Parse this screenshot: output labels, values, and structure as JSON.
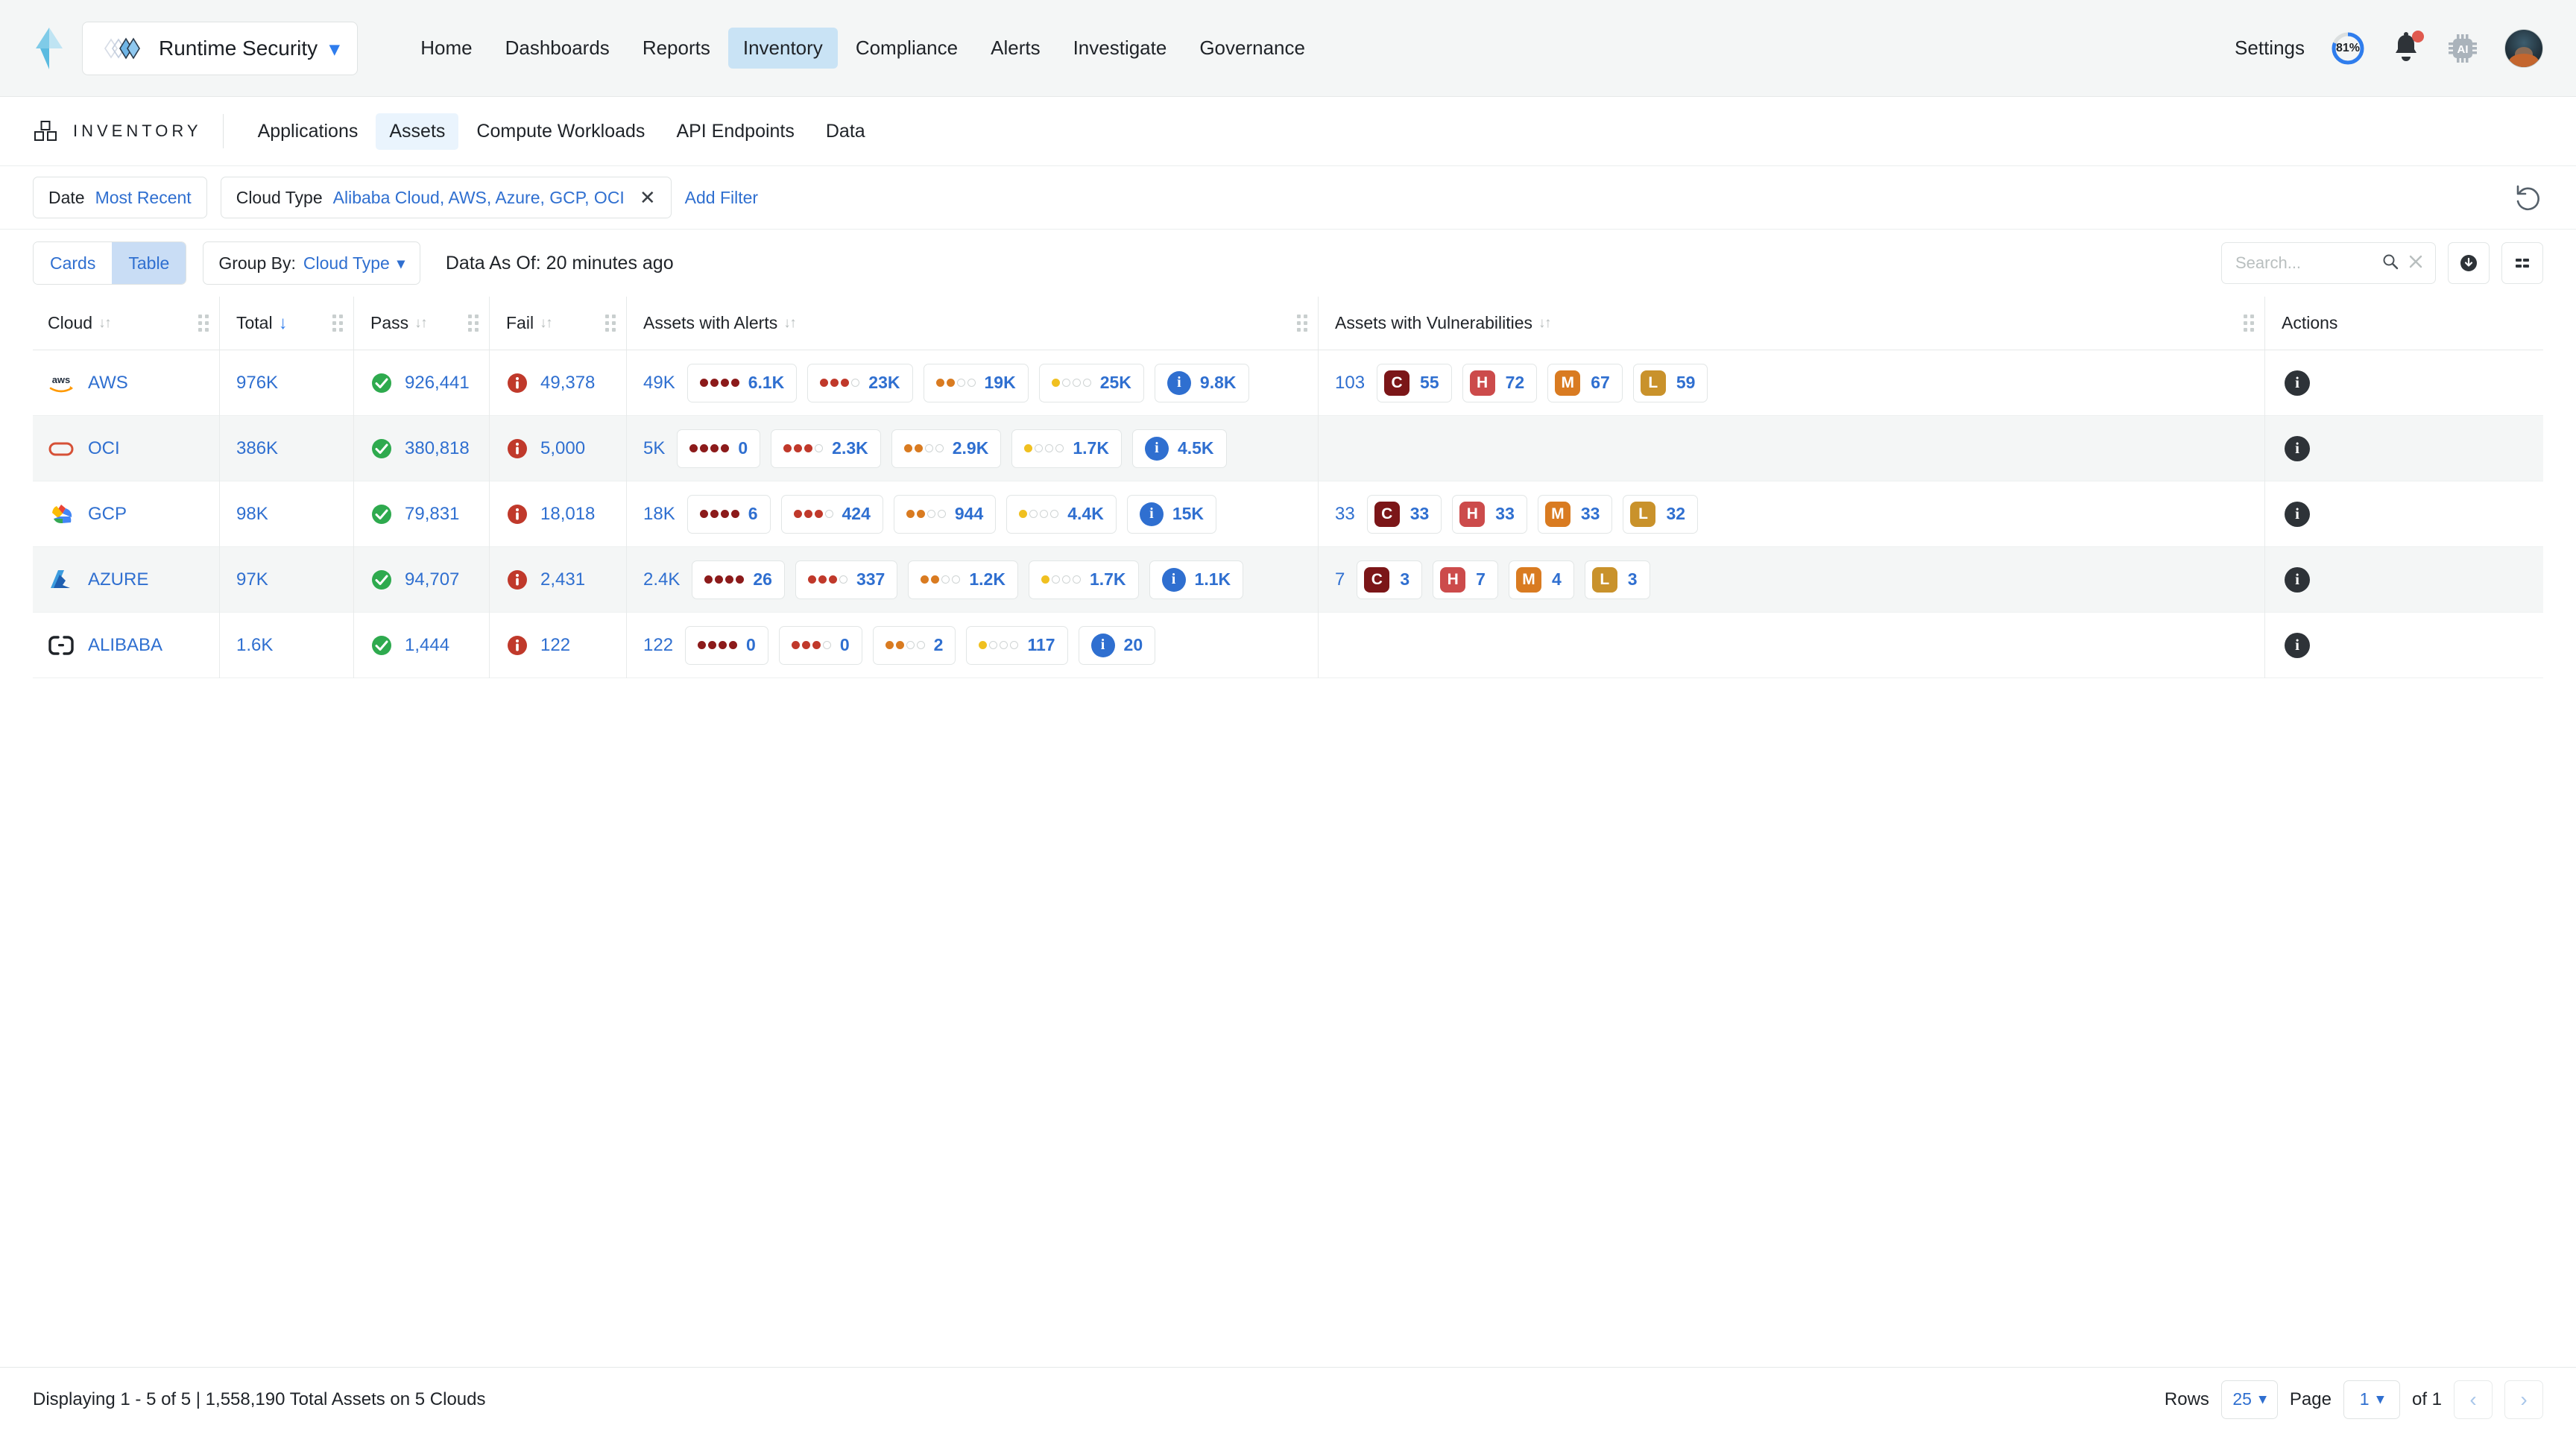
{
  "topbar": {
    "tenant": "Runtime Security",
    "nav": [
      {
        "label": "Home",
        "active": false
      },
      {
        "label": "Dashboards",
        "active": false
      },
      {
        "label": "Reports",
        "active": false
      },
      {
        "label": "Inventory",
        "active": true
      },
      {
        "label": "Compliance",
        "active": false
      },
      {
        "label": "Alerts",
        "active": false
      },
      {
        "label": "Investigate",
        "active": false
      },
      {
        "label": "Governance",
        "active": false
      }
    ],
    "settings_label": "Settings",
    "score_percent": "81%",
    "score_value": 81,
    "ai_icon_label": "AI"
  },
  "section": {
    "title": "INVENTORY",
    "tabs": [
      {
        "label": "Applications",
        "active": false
      },
      {
        "label": "Assets",
        "active": true
      },
      {
        "label": "Compute Workloads",
        "active": false
      },
      {
        "label": "API Endpoints",
        "active": false
      },
      {
        "label": "Data",
        "active": false
      }
    ]
  },
  "filters": {
    "date": {
      "key": "Date",
      "value": "Most Recent"
    },
    "cloud_type": {
      "key": "Cloud Type",
      "value": "Alibaba Cloud, AWS, Azure, GCP, OCI"
    },
    "add_filter": "Add Filter"
  },
  "toolbar": {
    "view_cards": "Cards",
    "view_table": "Table",
    "active_view": "Table",
    "group_by_label": "Group By:",
    "group_by_value": "Cloud Type",
    "data_as_of_label": "Data As Of:",
    "data_as_of_value": "20 minutes ago",
    "search_placeholder": "Search...",
    "search_value": ""
  },
  "table": {
    "columns": [
      {
        "key": "cloud",
        "label": "Cloud",
        "sorted": false
      },
      {
        "key": "total",
        "label": "Total",
        "sorted": true,
        "dir": "desc"
      },
      {
        "key": "pass",
        "label": "Pass",
        "sorted": false
      },
      {
        "key": "fail",
        "label": "Fail",
        "sorted": false
      },
      {
        "key": "alerts",
        "label": "Assets with Alerts",
        "sorted": false
      },
      {
        "key": "vulns",
        "label": "Assets with Vulnerabilities",
        "sorted": false
      },
      {
        "key": "actions",
        "label": "Actions",
        "sorted": false
      }
    ],
    "rows": [
      {
        "cloud": "AWS",
        "icon": "aws-icon",
        "total": "976K",
        "pass": "926,441",
        "fail": "49,378",
        "alerts_total": "49K",
        "alerts": [
          {
            "sev": "critical",
            "filled": 4,
            "value": "6.1K",
            "color": "#8c1b1b"
          },
          {
            "sev": "high",
            "filled": 3,
            "value": "23K",
            "color": "#c0392b"
          },
          {
            "sev": "medium",
            "filled": 2,
            "value": "19K",
            "color": "#d97b21"
          },
          {
            "sev": "low",
            "filled": 1,
            "value": "25K",
            "color": "#f0c020"
          },
          {
            "sev": "info",
            "filled": 0,
            "value": "9.8K",
            "color": "#2f6fd0"
          }
        ],
        "vulns_total": "103",
        "vulns": [
          {
            "sev": "C",
            "value": "55",
            "color": "#7b1618"
          },
          {
            "sev": "H",
            "value": "72",
            "color": "#cc4b4b"
          },
          {
            "sev": "M",
            "value": "67",
            "color": "#d97b21"
          },
          {
            "sev": "L",
            "value": "59",
            "color": "#c9922b"
          }
        ]
      },
      {
        "cloud": "OCI",
        "icon": "oci-icon",
        "total": "386K",
        "pass": "380,818",
        "fail": "5,000",
        "alerts_total": "5K",
        "alerts": [
          {
            "sev": "critical",
            "filled": 4,
            "value": "0",
            "color": "#8c1b1b"
          },
          {
            "sev": "high",
            "filled": 3,
            "value": "2.3K",
            "color": "#c0392b"
          },
          {
            "sev": "medium",
            "filled": 2,
            "value": "2.9K",
            "color": "#d97b21"
          },
          {
            "sev": "low",
            "filled": 1,
            "value": "1.7K",
            "color": "#f0c020"
          },
          {
            "sev": "info",
            "filled": 0,
            "value": "4.5K",
            "color": "#2f6fd0"
          }
        ],
        "vulns_total": "",
        "vulns": []
      },
      {
        "cloud": "GCP",
        "icon": "gcp-icon",
        "total": "98K",
        "pass": "79,831",
        "fail": "18,018",
        "alerts_total": "18K",
        "alerts": [
          {
            "sev": "critical",
            "filled": 4,
            "value": "6",
            "color": "#8c1b1b"
          },
          {
            "sev": "high",
            "filled": 3,
            "value": "424",
            "color": "#c0392b"
          },
          {
            "sev": "medium",
            "filled": 2,
            "value": "944",
            "color": "#d97b21"
          },
          {
            "sev": "low",
            "filled": 1,
            "value": "4.4K",
            "color": "#f0c020"
          },
          {
            "sev": "info",
            "filled": 0,
            "value": "15K",
            "color": "#2f6fd0"
          }
        ],
        "vulns_total": "33",
        "vulns": [
          {
            "sev": "C",
            "value": "33",
            "color": "#7b1618"
          },
          {
            "sev": "H",
            "value": "33",
            "color": "#cc4b4b"
          },
          {
            "sev": "M",
            "value": "33",
            "color": "#d97b21"
          },
          {
            "sev": "L",
            "value": "32",
            "color": "#c9922b"
          }
        ]
      },
      {
        "cloud": "AZURE",
        "icon": "azure-icon",
        "total": "97K",
        "pass": "94,707",
        "fail": "2,431",
        "alerts_total": "2.4K",
        "alerts": [
          {
            "sev": "critical",
            "filled": 4,
            "value": "26",
            "color": "#8c1b1b"
          },
          {
            "sev": "high",
            "filled": 3,
            "value": "337",
            "color": "#c0392b"
          },
          {
            "sev": "medium",
            "filled": 2,
            "value": "1.2K",
            "color": "#d97b21"
          },
          {
            "sev": "low",
            "filled": 1,
            "value": "1.7K",
            "color": "#f0c020"
          },
          {
            "sev": "info",
            "filled": 0,
            "value": "1.1K",
            "color": "#2f6fd0"
          }
        ],
        "vulns_total": "7",
        "vulns": [
          {
            "sev": "C",
            "value": "3",
            "color": "#7b1618"
          },
          {
            "sev": "H",
            "value": "7",
            "color": "#cc4b4b"
          },
          {
            "sev": "M",
            "value": "4",
            "color": "#d97b21"
          },
          {
            "sev": "L",
            "value": "3",
            "color": "#c9922b"
          }
        ]
      },
      {
        "cloud": "ALIBABA",
        "icon": "alibaba-icon",
        "total": "1.6K",
        "pass": "1,444",
        "fail": "122",
        "alerts_total": "122",
        "alerts": [
          {
            "sev": "critical",
            "filled": 4,
            "value": "0",
            "color": "#8c1b1b"
          },
          {
            "sev": "high",
            "filled": 3,
            "value": "0",
            "color": "#c0392b"
          },
          {
            "sev": "medium",
            "filled": 2,
            "value": "2",
            "color": "#d97b21"
          },
          {
            "sev": "low",
            "filled": 1,
            "value": "117",
            "color": "#f0c020"
          },
          {
            "sev": "info",
            "filled": 0,
            "value": "20",
            "color": "#2f6fd0"
          }
        ],
        "vulns_total": "",
        "vulns": []
      }
    ]
  },
  "footer": {
    "summary": "Displaying 1 - 5 of 5  |  1,558,190 Total Assets on 5 Clouds",
    "rows_label": "Rows",
    "rows_value": "25",
    "page_label": "Page",
    "page_value": "1",
    "of_label": "of 1"
  }
}
